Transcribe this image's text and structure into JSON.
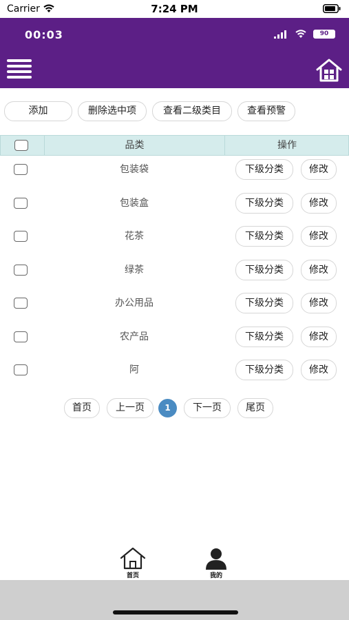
{
  "status_bar": {
    "carrier": "Carrier",
    "time": "7:24 PM"
  },
  "app_bar": {
    "time": "00:03",
    "battery": "90"
  },
  "toolbar": {
    "add": "添加",
    "delete_selected": "删除选中项",
    "view_secondary": "查看二级类目",
    "view_warning": "查看预警"
  },
  "table": {
    "headers": {
      "category": "品类",
      "actions": "操作"
    },
    "action_labels": {
      "sub": "下级分类",
      "edit": "修改"
    },
    "rows": [
      {
        "name": "包装袋"
      },
      {
        "name": "包装盒"
      },
      {
        "name": "花茶"
      },
      {
        "name": "绿茶"
      },
      {
        "name": "办公用品"
      },
      {
        "name": "农产品"
      },
      {
        "name": "阿"
      }
    ]
  },
  "pagination": {
    "first": "首页",
    "prev": "上一页",
    "current": "1",
    "next": "下一页",
    "last": "尾页"
  },
  "tabbar": {
    "home": "首页",
    "mine": "我的"
  },
  "colors": {
    "header": "#5c1f86",
    "table_header": "#d5ecec",
    "pager_current": "#4a8bc2"
  }
}
